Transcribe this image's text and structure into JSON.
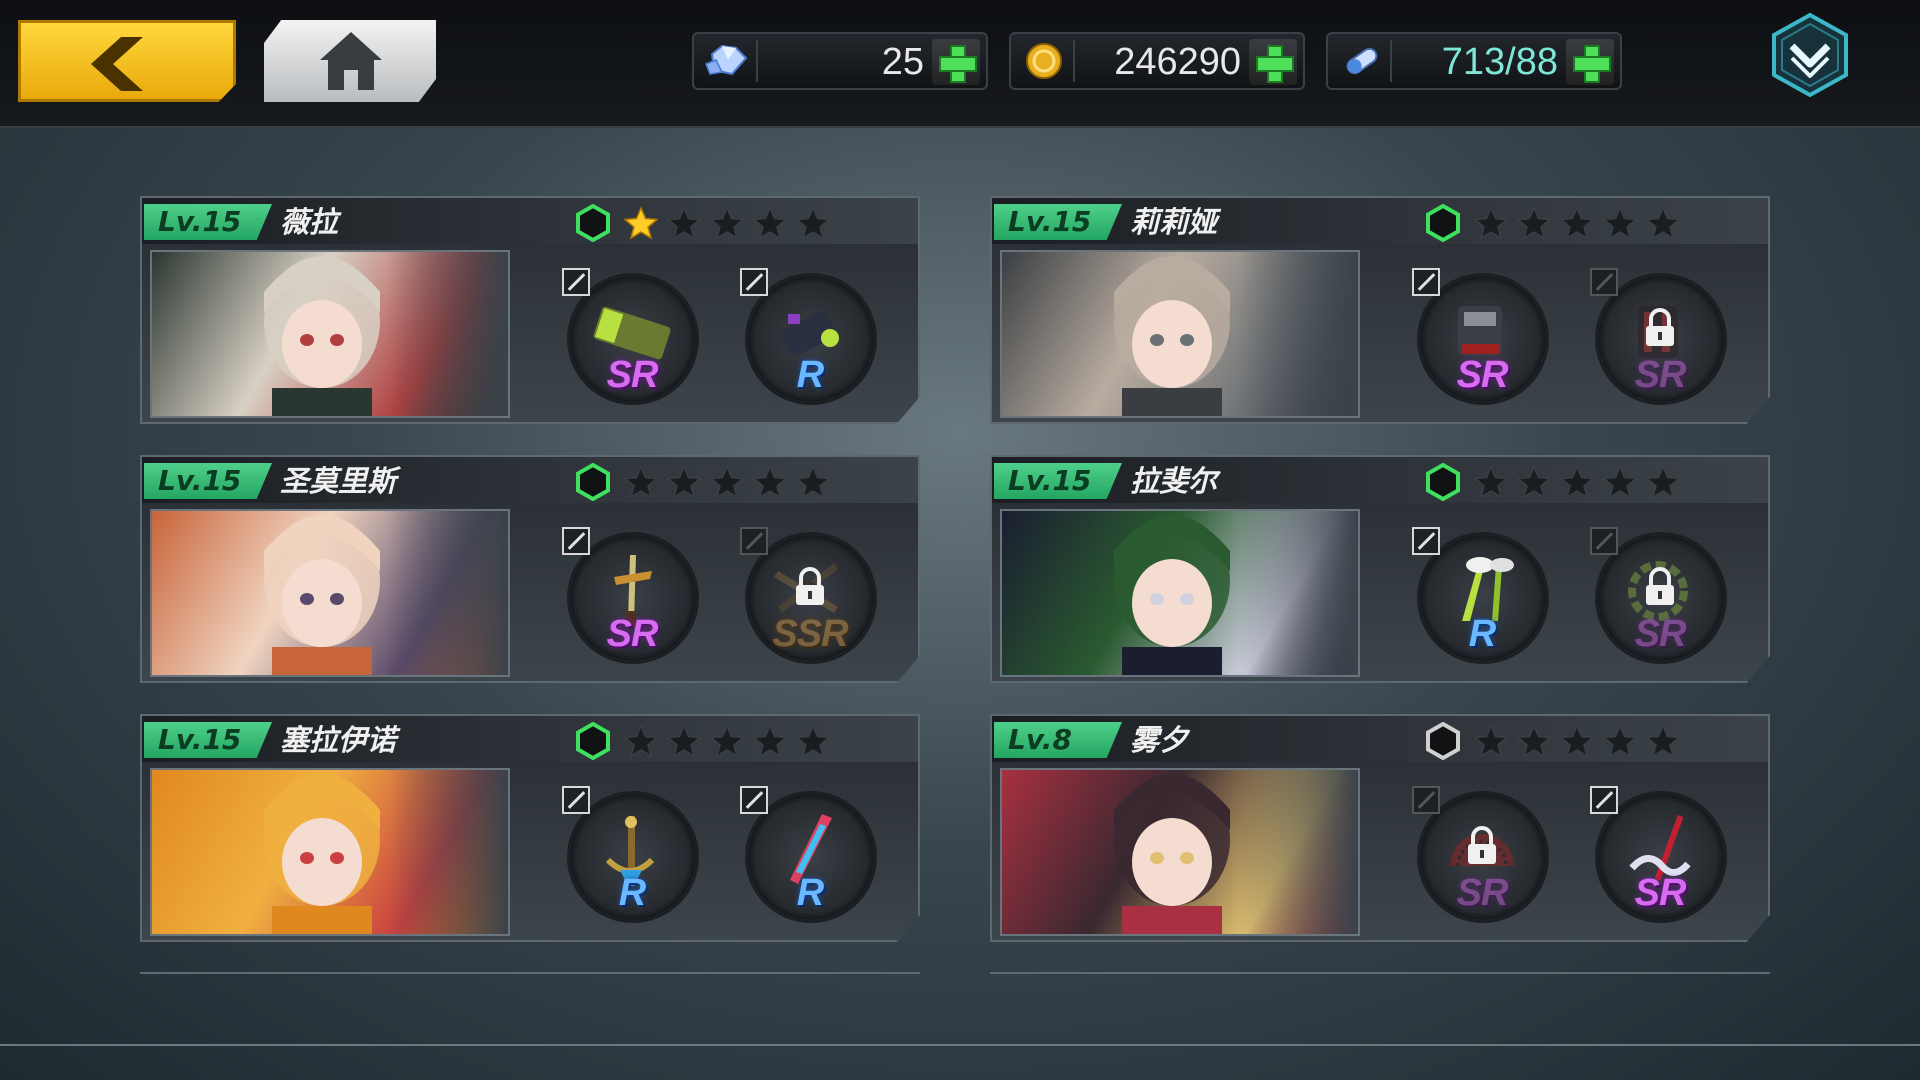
{
  "resources": {
    "gems": "25",
    "gold": "246290",
    "stamina": "713/88"
  },
  "colors": {
    "level_badge": "#2fb56e",
    "star_gold": "#ffcc2a",
    "star_empty": "#1a1d20",
    "hex_active": "#3fe060",
    "hex_inactive": "#d0d0d0"
  },
  "characters": [
    {
      "level": "Lv.15",
      "name": "薇拉",
      "stars": 1,
      "awakened": true,
      "portrait_colors": [
        "#d8d0c4",
        "#2a3630",
        "#b04040"
      ],
      "slots": [
        {
          "rarity": "SR",
          "locked": false,
          "icon": "death-launcher-icon"
        },
        {
          "rarity": "R",
          "locked": false,
          "icon": "blaster-icon"
        }
      ]
    },
    {
      "level": "Lv.15",
      "name": "莉莉娅",
      "stars": 0,
      "awakened": true,
      "portrait_colors": [
        "#b8aca0",
        "#3a3e42",
        "#6b7074"
      ],
      "slots": [
        {
          "rarity": "SR",
          "locked": false,
          "icon": "gauntlet-icon"
        },
        {
          "rarity": "SR",
          "locked": true,
          "icon": "claw-icon"
        }
      ]
    },
    {
      "level": "Lv.15",
      "name": "圣莫里斯",
      "stars": 0,
      "awakened": true,
      "portrait_colors": [
        "#f0d4c0",
        "#c8643a",
        "#5a4a6a"
      ],
      "slots": [
        {
          "rarity": "SR",
          "locked": false,
          "icon": "golden-sword-icon"
        },
        {
          "rarity": "SSR",
          "locked": true,
          "icon": "spider-blade-icon"
        }
      ]
    },
    {
      "level": "Lv.15",
      "name": "拉斐尔",
      "stars": 0,
      "awakened": true,
      "portrait_colors": [
        "#2a5a30",
        "#1a1e30",
        "#d0d0e0"
      ],
      "slots": [
        {
          "rarity": "R",
          "locked": false,
          "icon": "feather-blades-icon"
        },
        {
          "rarity": "SR",
          "locked": true,
          "icon": "chain-ring-icon"
        }
      ]
    },
    {
      "level": "Lv.15",
      "name": "塞拉伊诺",
      "stars": 0,
      "awakened": true,
      "portrait_colors": [
        "#f0b040",
        "#e08820",
        "#c84040"
      ],
      "slots": [
        {
          "rarity": "R",
          "locked": false,
          "icon": "anchor-staff-icon"
        },
        {
          "rarity": "R",
          "locked": false,
          "icon": "energy-blade-icon"
        }
      ]
    },
    {
      "level": "Lv.8",
      "name": "雾夕",
      "stars": 0,
      "awakened": false,
      "portrait_colors": [
        "#3a2830",
        "#a83040",
        "#e0c070"
      ],
      "slots": [
        {
          "rarity": "SR",
          "locked": true,
          "icon": "feather-fan-icon"
        },
        {
          "rarity": "SR",
          "locked": false,
          "icon": "ribbon-staff-icon"
        }
      ]
    }
  ]
}
